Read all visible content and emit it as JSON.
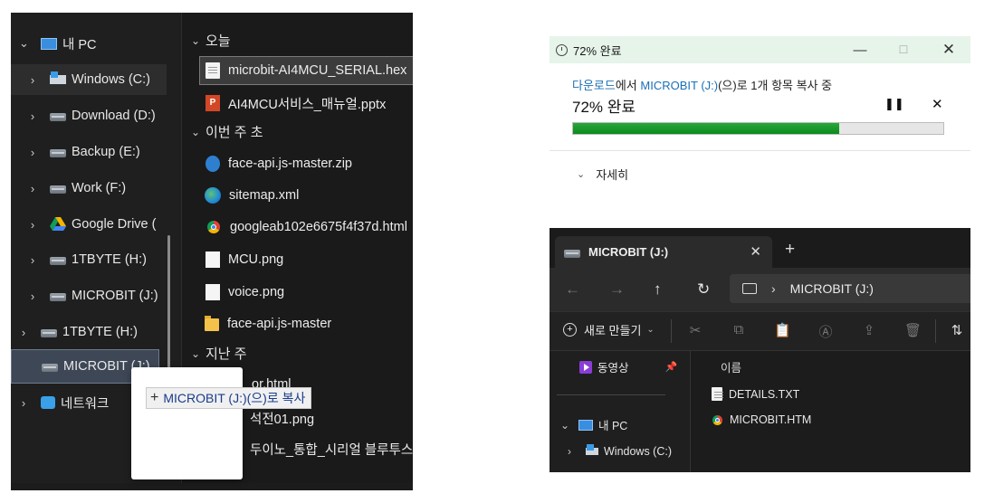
{
  "left_explorer": {
    "nav": {
      "items": [
        {
          "label": "내 PC",
          "icon": "pc-icon"
        },
        {
          "label": "Windows (C:)",
          "icon": "windows-drive-icon"
        },
        {
          "label": "Download (D:)",
          "icon": "drive-icon"
        },
        {
          "label": "Backup (E:)",
          "icon": "drive-icon"
        },
        {
          "label": "Work (F:)",
          "icon": "drive-icon"
        },
        {
          "label": "Google Drive (",
          "icon": "google-drive-icon"
        },
        {
          "label": "1TBYTE (H:)",
          "icon": "drive-icon"
        },
        {
          "label": "MICROBIT (J:)",
          "icon": "drive-icon"
        },
        {
          "label": "1TBYTE (H:)",
          "icon": "drive-icon"
        },
        {
          "label": "MICROBIT (J:)",
          "icon": "drive-icon"
        },
        {
          "label": "네트워크",
          "icon": "network-icon"
        }
      ]
    },
    "files": {
      "groups": [
        {
          "label": "오늘"
        },
        {
          "label": "이번 주 초"
        },
        {
          "label": "지난 주"
        }
      ],
      "items": [
        {
          "label": "microbit-AI4MCU_SERIAL.hex",
          "icon": "document-icon"
        },
        {
          "label": "AI4MCU서비스_매뉴얼.pptx",
          "icon": "powerpoint-icon"
        },
        {
          "label": "face-api.js-master.zip",
          "icon": "zip-icon"
        },
        {
          "label": "sitemap.xml",
          "icon": "edge-icon"
        },
        {
          "label": "googleab102e6675f4f37d.html",
          "icon": "chrome-icon"
        },
        {
          "label": "MCU.png",
          "icon": "image-icon"
        },
        {
          "label": "voice.png",
          "icon": "image-icon"
        },
        {
          "label": "face-api.js-master",
          "icon": "folder-icon"
        }
      ],
      "partial": [
        "or.html",
        "석전01.png",
        "두이노_통합_시리얼 블루투스"
      ]
    },
    "drag_tooltip": "MICROBIT (J:)(으)로 복사"
  },
  "copy_dialog": {
    "title": "72% 완료",
    "description": {
      "source": "다운로드",
      "from_suffix": "에서",
      "dest": "MICROBIT (J:)",
      "rest": "(으)로 1개 항목 복사 중"
    },
    "percent_label": "72% 완료",
    "progress_fraction": 0.72,
    "details_label": "자세히",
    "accent_color": "#27a73a"
  },
  "microbit_window": {
    "tab_title": "MICROBIT (J:)",
    "address_path": "MICROBIT (J:)",
    "new_button_label": "새로 만들기",
    "column_header": "이름",
    "nav": {
      "pinned": "동영상",
      "this_pc": "내 PC",
      "windows_drive": "Windows (C:)"
    },
    "files": [
      {
        "label": "DETAILS.TXT",
        "icon": "document-icon"
      },
      {
        "label": "MICROBIT.HTM",
        "icon": "chrome-icon"
      }
    ]
  }
}
